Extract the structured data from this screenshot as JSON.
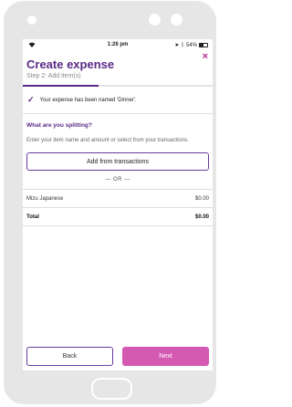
{
  "status_bar": {
    "time": "1:26 pm",
    "battery": "54%",
    "battery_level": 0.54,
    "wifi_icon": "wifi-icon",
    "location_icon": "location-arrow-icon",
    "bluetooth_icon": "bluetooth-icon"
  },
  "header": {
    "title": "Create expense",
    "subtitle": "Step 2: Add item(s)",
    "close_label": "×",
    "progress": 0.4
  },
  "notice": {
    "text": "Your expense has been named 'Dinner'."
  },
  "splitting": {
    "heading": "What are you splitting?",
    "help_text": "Enter your item name and amount or select from your transactions.",
    "add_button_label": "Add from transactions",
    "separator_label": "— OR —"
  },
  "items": [
    {
      "name": "Mizu Japanese",
      "amount": "$0.00"
    }
  ],
  "total": {
    "label": "Total",
    "amount": "$0.00"
  },
  "footer": {
    "back_label": "Back",
    "next_label": "Next"
  },
  "colors": {
    "accent": "#5a2a86",
    "next_button": "#d35ab0",
    "close_icon": "#b52a8a"
  }
}
